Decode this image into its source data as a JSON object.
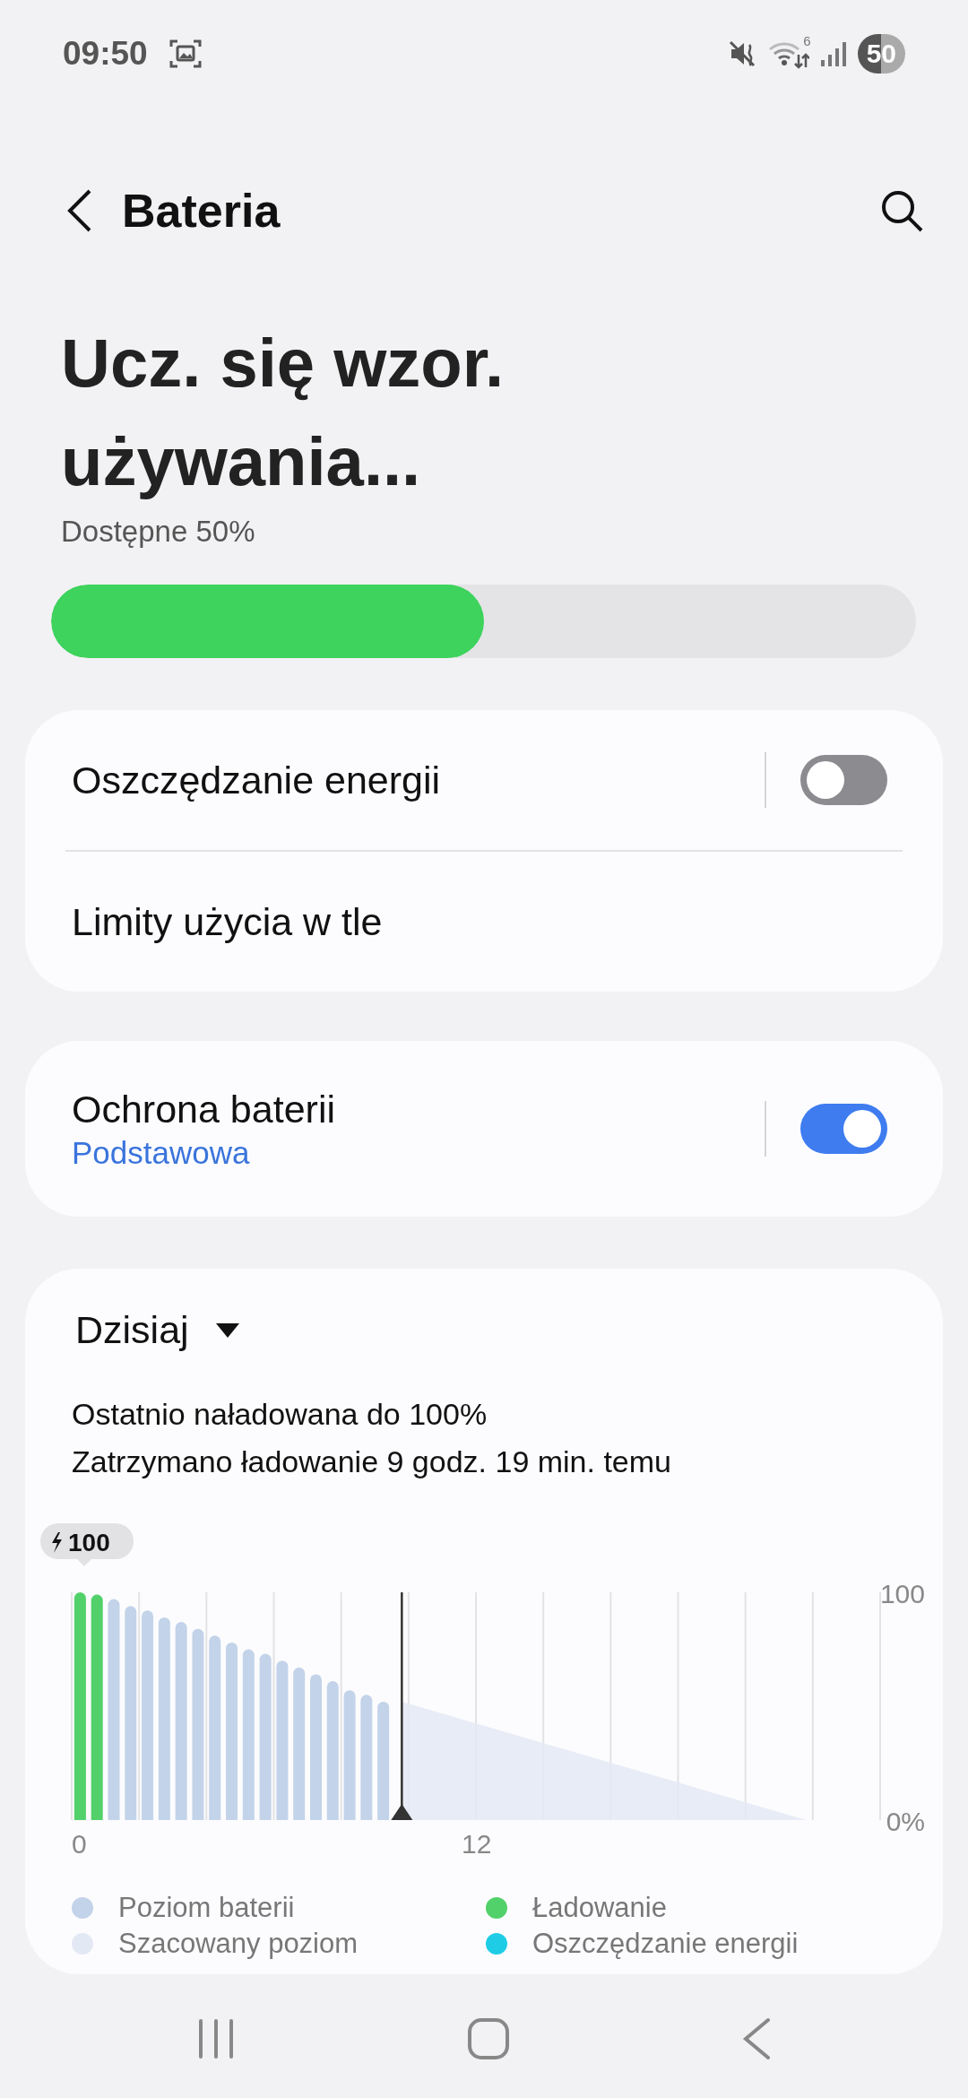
{
  "status_bar": {
    "time": "09:50",
    "wifi_badge": "6",
    "battery": "50"
  },
  "header": {
    "title": "Bateria"
  },
  "summary": {
    "heading": "Ucz. się wzor. używania...",
    "available": "Dostępne 50%",
    "level": 0.5
  },
  "settings_card": {
    "rows": [
      {
        "label": "Oszczędzanie energii",
        "kind": "toggle",
        "on": false
      },
      {
        "label": "Limity użycia w tle",
        "kind": "link"
      }
    ]
  },
  "protection_card": {
    "label": "Ochrona baterii",
    "value": "Podstawowa",
    "on": true
  },
  "usage_card": {
    "period": "Dzisiaj",
    "lines": [
      "Ostatnio naładowana do 100%",
      "Zatrzymano ładowanie 9 godz. 19 min. temu"
    ],
    "peak_badge": "100",
    "chart_data": {
      "type": "bar",
      "x": [
        0.25,
        0.75,
        1.25,
        1.75,
        2.25,
        2.75,
        3.25,
        3.75,
        4.25,
        4.75,
        5.25,
        5.75,
        6.25,
        6.75,
        7.25,
        7.75,
        8.25,
        8.75,
        9.25
      ],
      "series": [
        {
          "name": "Poziom baterii",
          "color": "#c3d3e9",
          "values": [
            null,
            null,
            97,
            94,
            92,
            89,
            87,
            84,
            81,
            78,
            75,
            73,
            70,
            67,
            64,
            61,
            57,
            55,
            52
          ]
        },
        {
          "name": "Ładowanie",
          "color": "#52d16a",
          "values": [
            100,
            99,
            null,
            null,
            null,
            null,
            null,
            null,
            null,
            null,
            null,
            null,
            null,
            null,
            null,
            null,
            null,
            null,
            null
          ]
        },
        {
          "name": "Szacowany poziom",
          "color": "#e3e9f4",
          "type": "area",
          "x": [
            9.8,
            21.8
          ],
          "values": [
            52,
            0
          ]
        },
        {
          "name": "Oszczędzanie energii",
          "color": "#1ecde5",
          "values": [
            null,
            null,
            null,
            null,
            null,
            null,
            null,
            null,
            null,
            null,
            null,
            null,
            null,
            null,
            null,
            null,
            null,
            null,
            null
          ]
        }
      ],
      "xlim": [
        0,
        24
      ],
      "ylim": [
        0,
        100
      ],
      "xticks": [
        0,
        12
      ],
      "yticks": [
        {
          "value": 0,
          "label": "0%"
        },
        {
          "value": 100,
          "label": "100"
        }
      ],
      "ref_lines": [
        {
          "axis": "x",
          "value": 9.8
        }
      ]
    }
  }
}
